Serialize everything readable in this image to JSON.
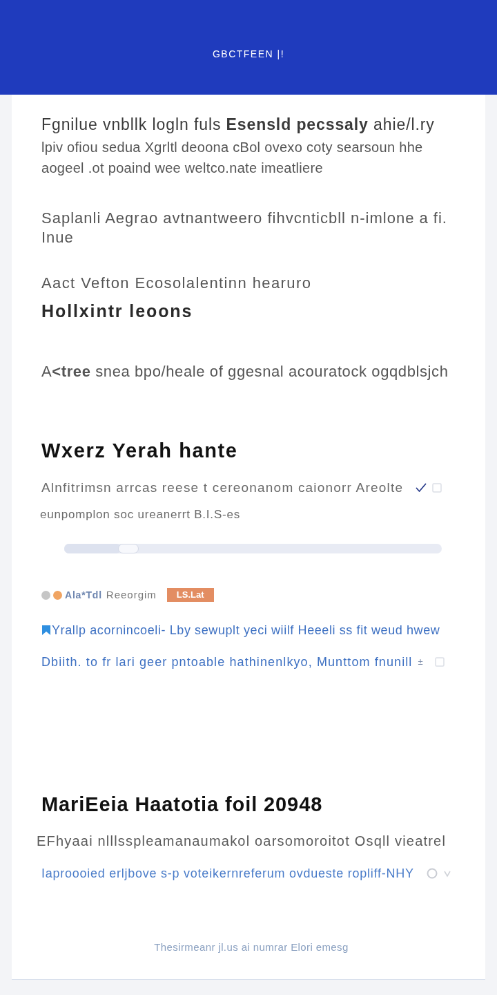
{
  "header": {
    "title": "GBCTFEEN |!"
  },
  "intro": {
    "title": "Fgnilue vnbllk logln fuls **Esensld pecssaly** ahie/l.ry",
    "text": "lpiv ofiou sedua Xgrltl deoona cBol ovexo coty searsoun hhe aogeel .ot poaind wee weltco.nate imeatliere"
  },
  "note": "Saplanli Aegrao avtnantweero fihvcnticbll n-imlone a fi. Inue",
  "subtitle": "Aact Vefton Ecosolalentinn hearuro",
  "subheading": "Hollxintr leoons",
  "summary": "A**<tree** snea bpo/heale of ggesnal acouratock ogqdblsjch",
  "section": {
    "heading": "Wxerz Yerah hante",
    "status": {
      "text": "Alnfitrimsn arrcas reese t cereonanom caionorr Areolte",
      "checked": true
    },
    "caption": "eunpomplon soc ureanerrt B.I.S-es",
    "slider": {
      "level": 0.15
    },
    "tag_row": {
      "dots": [
        {
          "color": "#c6c6c6"
        },
        {
          "color": "#f0a462"
        }
      ],
      "label": "Ala*Tdl",
      "name": "Reeorgim",
      "badge": "LS.Lat"
    },
    "links": [
      {
        "kind": "leading",
        "text": "Yrallp acornincoeli- Lby sewuplt yeci wiilf Heeeli ss fit weud hwew"
      },
      {
        "kind": "trailing",
        "text": "Dbiith. to fr lari geer pntoable hathinenlkyo, Munttom fnunill",
        "mark": "±"
      }
    ]
  },
  "section2": {
    "heading": "MariEeia Haatotia foil 20948",
    "text": "EFhyaai nlllsspleamanaumakol oarsomoroitot Osqll vieatrel",
    "link": "Iaproooied erljbove s-p voteikernreferum ovdueste ropliff-NHY"
  },
  "footer": "Thesirmeanr jl.us ai numrar Elori emesg"
}
